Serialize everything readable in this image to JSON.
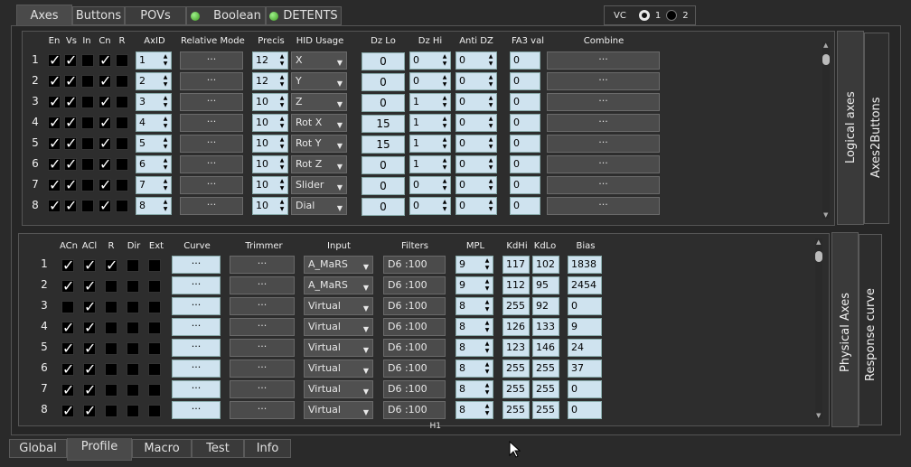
{
  "top_tabs": [
    {
      "label": "Axes",
      "active": true
    },
    {
      "label": "Buttons"
    },
    {
      "label": "POVs"
    },
    {
      "label": "Boolean",
      "led": true
    },
    {
      "label": "DETENTS",
      "led": true
    }
  ],
  "vc": {
    "label": "VC",
    "opt1": "1",
    "opt2": "2",
    "selected": "1"
  },
  "logical": {
    "tab_label": "Logical axes",
    "tab_label2": "Axes2Buttons",
    "headers": {
      "en": "En",
      "vs": "Vs",
      "in": "In",
      "cn": "Cn",
      "r": "R",
      "axid": "AxID",
      "relmode": "Relative Mode",
      "precis": "Precis",
      "hid": "HID Usage",
      "dzlo": "Dz Lo",
      "dzhi": "Dz Hi",
      "antidz": "Anti DZ",
      "fa3": "FA3 val",
      "combine": "Combine"
    },
    "rows": [
      {
        "n": "1",
        "en": true,
        "vs": true,
        "in": false,
        "cn": true,
        "r": false,
        "axid": "1",
        "rel": "···",
        "precis": "12",
        "hid": "X",
        "dzlo": "0",
        "dzhi": "0",
        "anti": "0",
        "fa3": "0",
        "combine": "···"
      },
      {
        "n": "2",
        "en": true,
        "vs": true,
        "in": false,
        "cn": true,
        "r": false,
        "axid": "2",
        "rel": "···",
        "precis": "12",
        "hid": "Y",
        "dzlo": "0",
        "dzhi": "0",
        "anti": "0",
        "fa3": "0",
        "combine": "···"
      },
      {
        "n": "3",
        "en": true,
        "vs": true,
        "in": false,
        "cn": true,
        "r": false,
        "axid": "3",
        "rel": "···",
        "precis": "10",
        "hid": "Z",
        "dzlo": "0",
        "dzhi": "1",
        "anti": "0",
        "fa3": "0",
        "combine": "···"
      },
      {
        "n": "4",
        "en": true,
        "vs": true,
        "in": false,
        "cn": true,
        "r": false,
        "axid": "4",
        "rel": "···",
        "precis": "10",
        "hid": "Rot X",
        "dzlo": "15",
        "dzhi": "1",
        "anti": "0",
        "fa3": "0",
        "combine": "···"
      },
      {
        "n": "5",
        "en": true,
        "vs": true,
        "in": false,
        "cn": true,
        "r": false,
        "axid": "5",
        "rel": "···",
        "precis": "10",
        "hid": "Rot Y",
        "dzlo": "15",
        "dzhi": "1",
        "anti": "0",
        "fa3": "0",
        "combine": "···"
      },
      {
        "n": "6",
        "en": true,
        "vs": true,
        "in": false,
        "cn": true,
        "r": false,
        "axid": "6",
        "rel": "···",
        "precis": "10",
        "hid": "Rot Z",
        "dzlo": "0",
        "dzhi": "1",
        "anti": "0",
        "fa3": "0",
        "combine": "···"
      },
      {
        "n": "7",
        "en": true,
        "vs": true,
        "in": false,
        "cn": true,
        "r": false,
        "axid": "7",
        "rel": "···",
        "precis": "10",
        "hid": "Slider",
        "dzlo": "0",
        "dzhi": "0",
        "anti": "0",
        "fa3": "0",
        "combine": "···"
      },
      {
        "n": "8",
        "en": true,
        "vs": true,
        "in": false,
        "cn": true,
        "r": false,
        "axid": "8",
        "rel": "···",
        "precis": "10",
        "hid": "Dial",
        "dzlo": "0",
        "dzhi": "0",
        "anti": "0",
        "fa3": "0",
        "combine": "···"
      }
    ]
  },
  "physical": {
    "tab_label": "Physical Axes",
    "tab_label2": "Response curve",
    "headers": {
      "acn": "ACn",
      "acl": "ACl",
      "r": "R",
      "dir": "Dir",
      "ext": "Ext",
      "curve": "Curve",
      "trimmer": "Trimmer",
      "input": "Input",
      "filters": "Filters",
      "mpl": "MPL",
      "kdhi": "KdHi",
      "kdlo": "KdLo",
      "bias": "Bias"
    },
    "rows": [
      {
        "n": "1",
        "acn": true,
        "acl": true,
        "r": true,
        "dir": false,
        "ext": false,
        "curve": "···",
        "trim": "···",
        "input": "A_MaRS",
        "filter": "D6 :100",
        "h": "H1",
        "mpl": "9",
        "kdhi": "117",
        "kdlo": "102",
        "bias": "1838"
      },
      {
        "n": "2",
        "acn": true,
        "acl": true,
        "r": false,
        "dir": false,
        "ext": false,
        "curve": "···",
        "trim": "···",
        "input": "A_MaRS",
        "filter": "D6 :100",
        "h": "H1",
        "mpl": "9",
        "kdhi": "112",
        "kdlo": "95",
        "bias": "2454"
      },
      {
        "n": "3",
        "acn": false,
        "acl": true,
        "r": false,
        "dir": false,
        "ext": false,
        "curve": "···",
        "trim": "···",
        "input": "Virtual",
        "filter": "D6 :100",
        "h": "H1",
        "mpl": "8",
        "kdhi": "255",
        "kdlo": "92",
        "bias": "0"
      },
      {
        "n": "4",
        "acn": true,
        "acl": true,
        "r": false,
        "dir": false,
        "ext": false,
        "curve": "···",
        "trim": "···",
        "input": "Virtual",
        "filter": "D6 :100",
        "h": "H1",
        "mpl": "8",
        "kdhi": "126",
        "kdlo": "133",
        "bias": "9"
      },
      {
        "n": "5",
        "acn": true,
        "acl": true,
        "r": false,
        "dir": false,
        "ext": false,
        "curve": "···",
        "trim": "···",
        "input": "Virtual",
        "filter": "D6 :100",
        "h": "H1",
        "mpl": "8",
        "kdhi": "123",
        "kdlo": "146",
        "bias": "24"
      },
      {
        "n": "6",
        "acn": true,
        "acl": true,
        "r": false,
        "dir": false,
        "ext": false,
        "curve": "···",
        "trim": "···",
        "input": "Virtual",
        "filter": "D6 :100",
        "h": "H1",
        "mpl": "8",
        "kdhi": "255",
        "kdlo": "255",
        "bias": "37"
      },
      {
        "n": "7",
        "acn": true,
        "acl": true,
        "r": false,
        "dir": false,
        "ext": false,
        "curve": "···",
        "trim": "···",
        "input": "Virtual",
        "filter": "D6 :100",
        "h": "H1",
        "mpl": "8",
        "kdhi": "255",
        "kdlo": "255",
        "bias": "0"
      },
      {
        "n": "8",
        "acn": true,
        "acl": true,
        "r": false,
        "dir": false,
        "ext": false,
        "curve": "···",
        "trim": "···",
        "input": "Virtual",
        "filter": "D6 :100",
        "h": "H1",
        "mpl": "8",
        "kdhi": "255",
        "kdlo": "255",
        "bias": "0"
      }
    ]
  },
  "bottom_tabs": [
    {
      "label": "Global"
    },
    {
      "label": "Profile",
      "active": true
    },
    {
      "label": "Macro"
    },
    {
      "label": "Test"
    },
    {
      "label": "Info"
    }
  ],
  "icons": {
    "led": "led-indicator-icon",
    "spin": "spinner-arrows-icon",
    "dropdown": "chevron-down-icon",
    "cursor": "mouse-cursor-icon"
  }
}
